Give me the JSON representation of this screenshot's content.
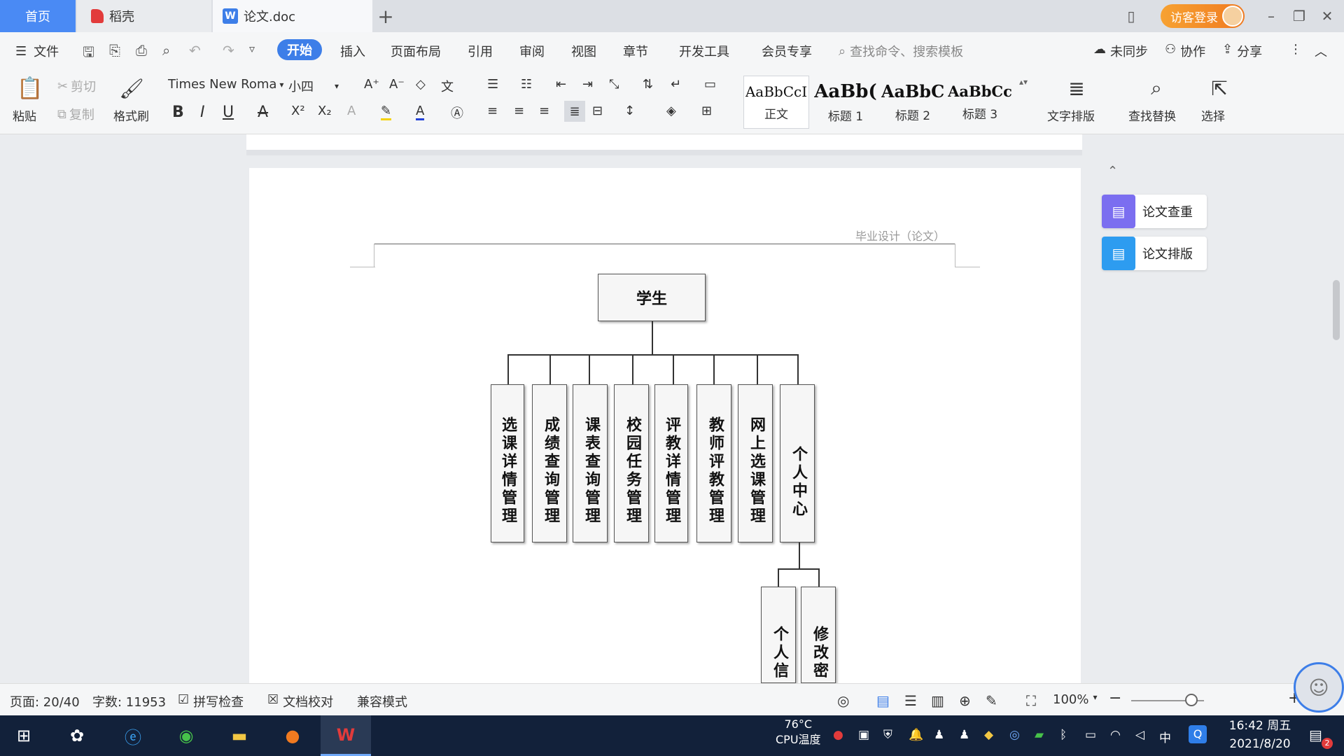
{
  "tabs": {
    "home": "首页",
    "docer": "稻壳",
    "doc": "论文.doc",
    "add": "+"
  },
  "login": "访客登录",
  "window": {
    "minimize": "–",
    "restore": "❐",
    "close": "✕"
  },
  "menu": {
    "file": "文件",
    "items": [
      "开始",
      "插入",
      "页面布局",
      "引用",
      "审阅",
      "视图",
      "章节",
      "开发工具",
      "会员专享"
    ],
    "search_placeholder": "查找命令、搜索模板",
    "sync": "未同步",
    "collab": "协作",
    "share": "分享"
  },
  "ribbon": {
    "paste": "粘贴",
    "cut": "剪切",
    "copy": "复制",
    "format_painter": "格式刷",
    "font_name": "Times New Roma",
    "font_size": "小四",
    "styles": [
      {
        "preview": "AaBbCcI",
        "name": "正文"
      },
      {
        "preview": "AaBb(",
        "name": "标题 1"
      },
      {
        "preview": "AaBbC",
        "name": "标题 2"
      },
      {
        "preview": "AaBbCc",
        "name": "标题 3"
      }
    ],
    "text_layout": "文字排版",
    "find_replace": "查找替换",
    "select": "选择"
  },
  "document": {
    "header_text": "毕业设计（论文）",
    "chart": {
      "root": "学生",
      "children": [
        "选课详情管理",
        "成绩查询管理",
        "课表查询管理",
        "校园任务管理",
        "评教详情管理",
        "教师评教管理",
        "网上选课管理",
        "个人中心"
      ],
      "grandchildren": [
        "个人信",
        "修改密"
      ]
    }
  },
  "side_panel": {
    "collapse": "⌃",
    "check": "论文查重",
    "layout": "论文排版"
  },
  "status": {
    "page": "页面: 20/40",
    "words": "字数: 11953",
    "spell": "拼写检查",
    "proof": "文档校对",
    "compat": "兼容模式",
    "zoom": "100%",
    "zoom_level": 0.83
  },
  "taskbar": {
    "temp": "76°C",
    "temp_label": "CPU温度",
    "ime": "中",
    "time": "16:42 周五",
    "date": "2021/8/20",
    "notif_count": "2"
  },
  "colors": {
    "accent": "#3d7ee8",
    "home_tab": "#4a8af4",
    "login": "#f08a24",
    "taskbar": "#12213a"
  }
}
